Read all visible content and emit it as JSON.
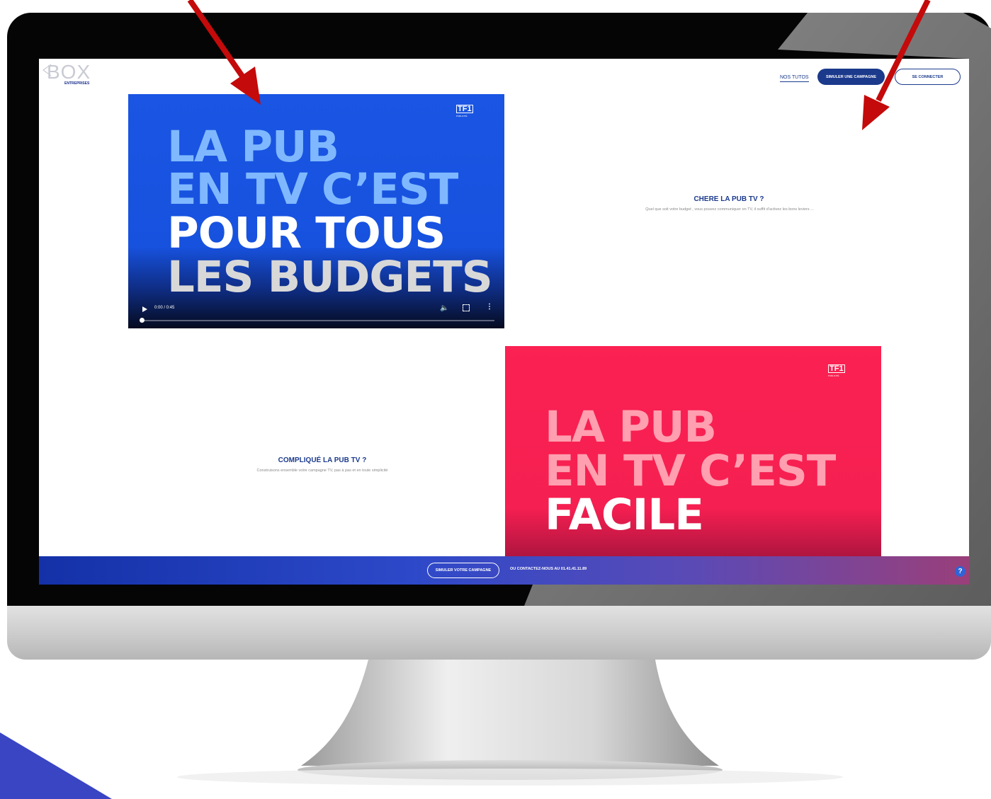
{
  "logo": {
    "text": "BOX",
    "sub": "ENTREPRISES"
  },
  "nav": {
    "tutos": "NOS TUTOS",
    "simulate": "SIMULER UNE CAMPAGNE",
    "login": "SE CONNECTER"
  },
  "video1": {
    "brand": "TF1",
    "brand_sub": "PUBLICITÉ",
    "line1": "LA PUB",
    "line2": "EN TV C’EST",
    "line3": "POUR TOUS",
    "line4": "LES BUDGETS",
    "time": "0:00 / 0:45"
  },
  "section1": {
    "title": "CHERE LA PUB TV ?",
    "desc": "Quel que soit votre budget , vous pouvez communiquer en TV, il suffit d’activez les bons leviers ..."
  },
  "section2": {
    "title": "COMPLIQUÉ LA PUB TV ?",
    "desc": "Construisons ensemble votre campagne TV, pas à pas et en toute simplicité"
  },
  "video2": {
    "brand": "TF1",
    "brand_sub": "PUBLICITÉ",
    "line1": "LA PUB",
    "line2": "EN TV C’EST",
    "line3": "FACILE"
  },
  "footer": {
    "simulate": "SIMULER VOTRE CAMPAGNE",
    "contact": "OU CONTACTEZ-NOUS AU 01.41.41.11.89",
    "help": "?"
  },
  "colors": {
    "primary": "#1b3a8c",
    "video_blue": "#1a55e3",
    "video_pink": "#fb2152",
    "arrow_red": "#c40a0a"
  }
}
